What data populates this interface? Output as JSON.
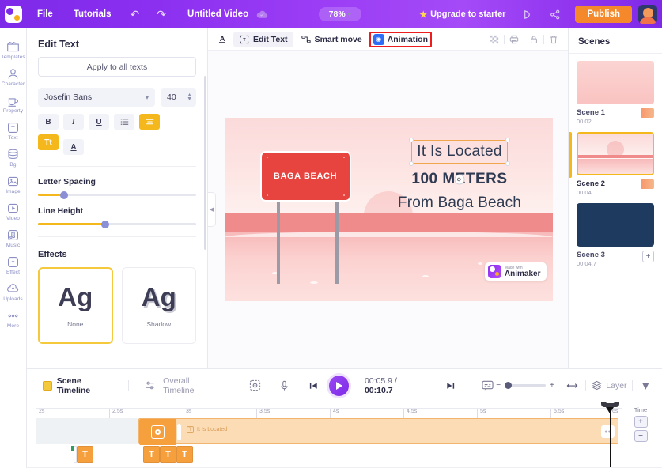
{
  "topbar": {
    "logo": "animaker-logo",
    "menu": [
      "File",
      "Tutorials"
    ],
    "undo_icon": "undo-icon",
    "redo_icon": "redo-icon",
    "project_title": "Untitled Video",
    "cloud_icon": "cloud-save-icon",
    "zoom_level": "78%",
    "upgrade_label": "Upgrade to starter",
    "preview_icon": "preview-icon",
    "share_icon": "share-icon",
    "publish_label": "Publish",
    "avatar": "user-avatar"
  },
  "rail": {
    "items": [
      {
        "label": "Templates",
        "icon": "templates-icon"
      },
      {
        "label": "Character",
        "icon": "character-icon"
      },
      {
        "label": "Property",
        "icon": "property-icon"
      },
      {
        "label": "Text",
        "icon": "text-icon"
      },
      {
        "label": "Bg",
        "icon": "background-icon"
      },
      {
        "label": "Image",
        "icon": "image-icon"
      },
      {
        "label": "Video",
        "icon": "video-icon"
      },
      {
        "label": "Music",
        "icon": "music-icon"
      },
      {
        "label": "Effect",
        "icon": "effect-icon"
      },
      {
        "label": "Uploads",
        "icon": "uploads-icon"
      },
      {
        "label": "More",
        "icon": "more-icon"
      }
    ]
  },
  "panel": {
    "title": "Edit Text",
    "apply_all_label": "Apply to all texts",
    "font_family": "Josefin Sans",
    "font_size": "40",
    "format_buttons": [
      {
        "name": "bold-button",
        "label": "B",
        "active": false
      },
      {
        "name": "italic-button",
        "label": "I",
        "active": false
      },
      {
        "name": "underline-button",
        "label": "U",
        "active": false
      },
      {
        "name": "list-button",
        "label": "list",
        "active": false
      },
      {
        "name": "align-button",
        "label": "align",
        "active": true
      },
      {
        "name": "text-case-button",
        "label": "Tt",
        "active": true
      },
      {
        "name": "text-color-button",
        "label": "A",
        "active": false
      }
    ],
    "letter_spacing_label": "Letter Spacing",
    "letter_spacing_value": 16,
    "line_height_label": "Line Height",
    "line_height_value": 42,
    "effects_label": "Effects",
    "effects": [
      {
        "sample": "Ag",
        "name": "None",
        "selected": true
      },
      {
        "sample": "Ag",
        "name": "Shadow",
        "selected": false
      }
    ]
  },
  "canvas_toolbar": {
    "text_color_icon": "text-color-icon",
    "edit_text_label": "Edit Text",
    "smart_move_label": "Smart move",
    "animation_label": "Animation",
    "highlight_color": "#ee1d1d",
    "right_icons": [
      "transparency-icon",
      "print-icon",
      "lock-icon",
      "delete-icon"
    ],
    "collapse_icon": "chevron-left-icon"
  },
  "stage": {
    "sign_text": "BAGA BEACH",
    "text_line_1": "It Is Located",
    "text_line_2": "100 METERS",
    "text_line_3": "From Baga Beach",
    "watermark_small": "Made with",
    "watermark_brand": "Animaker"
  },
  "scenes": {
    "title": "Scenes",
    "add_scene_icon": "plus-icon",
    "items": [
      {
        "name": "Scene 1",
        "duration": "00:02",
        "selected": false,
        "thumb": "#fbd2d0"
      },
      {
        "name": "Scene 2",
        "duration": "00:04",
        "selected": true,
        "thumb": "#fbdada"
      },
      {
        "name": "Scene 3",
        "duration": "00:04.7",
        "selected": false,
        "thumb": "#1e3a5f"
      }
    ]
  },
  "timeline": {
    "scene_tab": "Scene Timeline",
    "overall_tab": "Overall Timeline",
    "focus_icon": "focus-icon",
    "mic_icon": "microphone-icon",
    "prev_icon": "skip-back-icon",
    "play_icon": "play-icon",
    "current_time": "00:05.9",
    "total_time": "00:10.7",
    "next_icon": "skip-forward-icon",
    "subtitle_icon": "subtitle-icon",
    "zoom_minus": "−",
    "zoom_plus": "+",
    "fit_icon": "fit-width-icon",
    "layer_label": "Layer",
    "collapse_icon": "chevron-down-icon",
    "ruler_ticks": [
      "2s",
      "2.5s",
      "3s",
      "3.5s",
      "4s",
      "4.5s",
      "5s",
      "5.5s",
      "6s"
    ],
    "clip_label": "It Is Located",
    "time_label": "Time",
    "time_plus": "+",
    "time_minus": "−",
    "track_badges": [
      "T",
      "T",
      "T",
      "T"
    ]
  }
}
